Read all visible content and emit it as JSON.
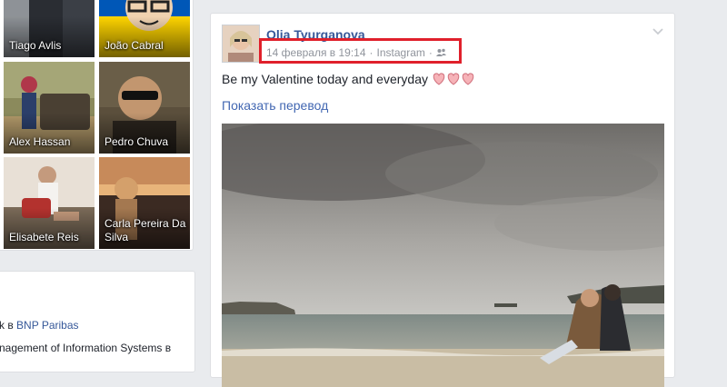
{
  "friends": [
    {
      "name": "Tiago Avlis"
    },
    {
      "name": "João Cabral"
    },
    {
      "name": "Alex Hassan"
    },
    {
      "name": "Pedro Chuva"
    },
    {
      "name": "Elisabete Reis"
    },
    {
      "name": "Carla Pereira Da Silva"
    }
  ],
  "about": {
    "line1_prefix": "k в ",
    "line1_link": "BNP Paribas",
    "line2": "nagement of Information Systems в"
  },
  "post": {
    "author": "Olia Tyurganova",
    "date": "14 февраля в 19:14",
    "separator": "·",
    "source": "Instagram",
    "audience_icon": "friends-icon",
    "text": "Be my Valentine today and everyday",
    "emoji": "heart-emoji",
    "translate_label": "Показать перевод"
  },
  "colors": {
    "link": "#365899",
    "highlight": "#e0202b",
    "meta": "#90949c",
    "page_bg": "#e9ebee"
  }
}
